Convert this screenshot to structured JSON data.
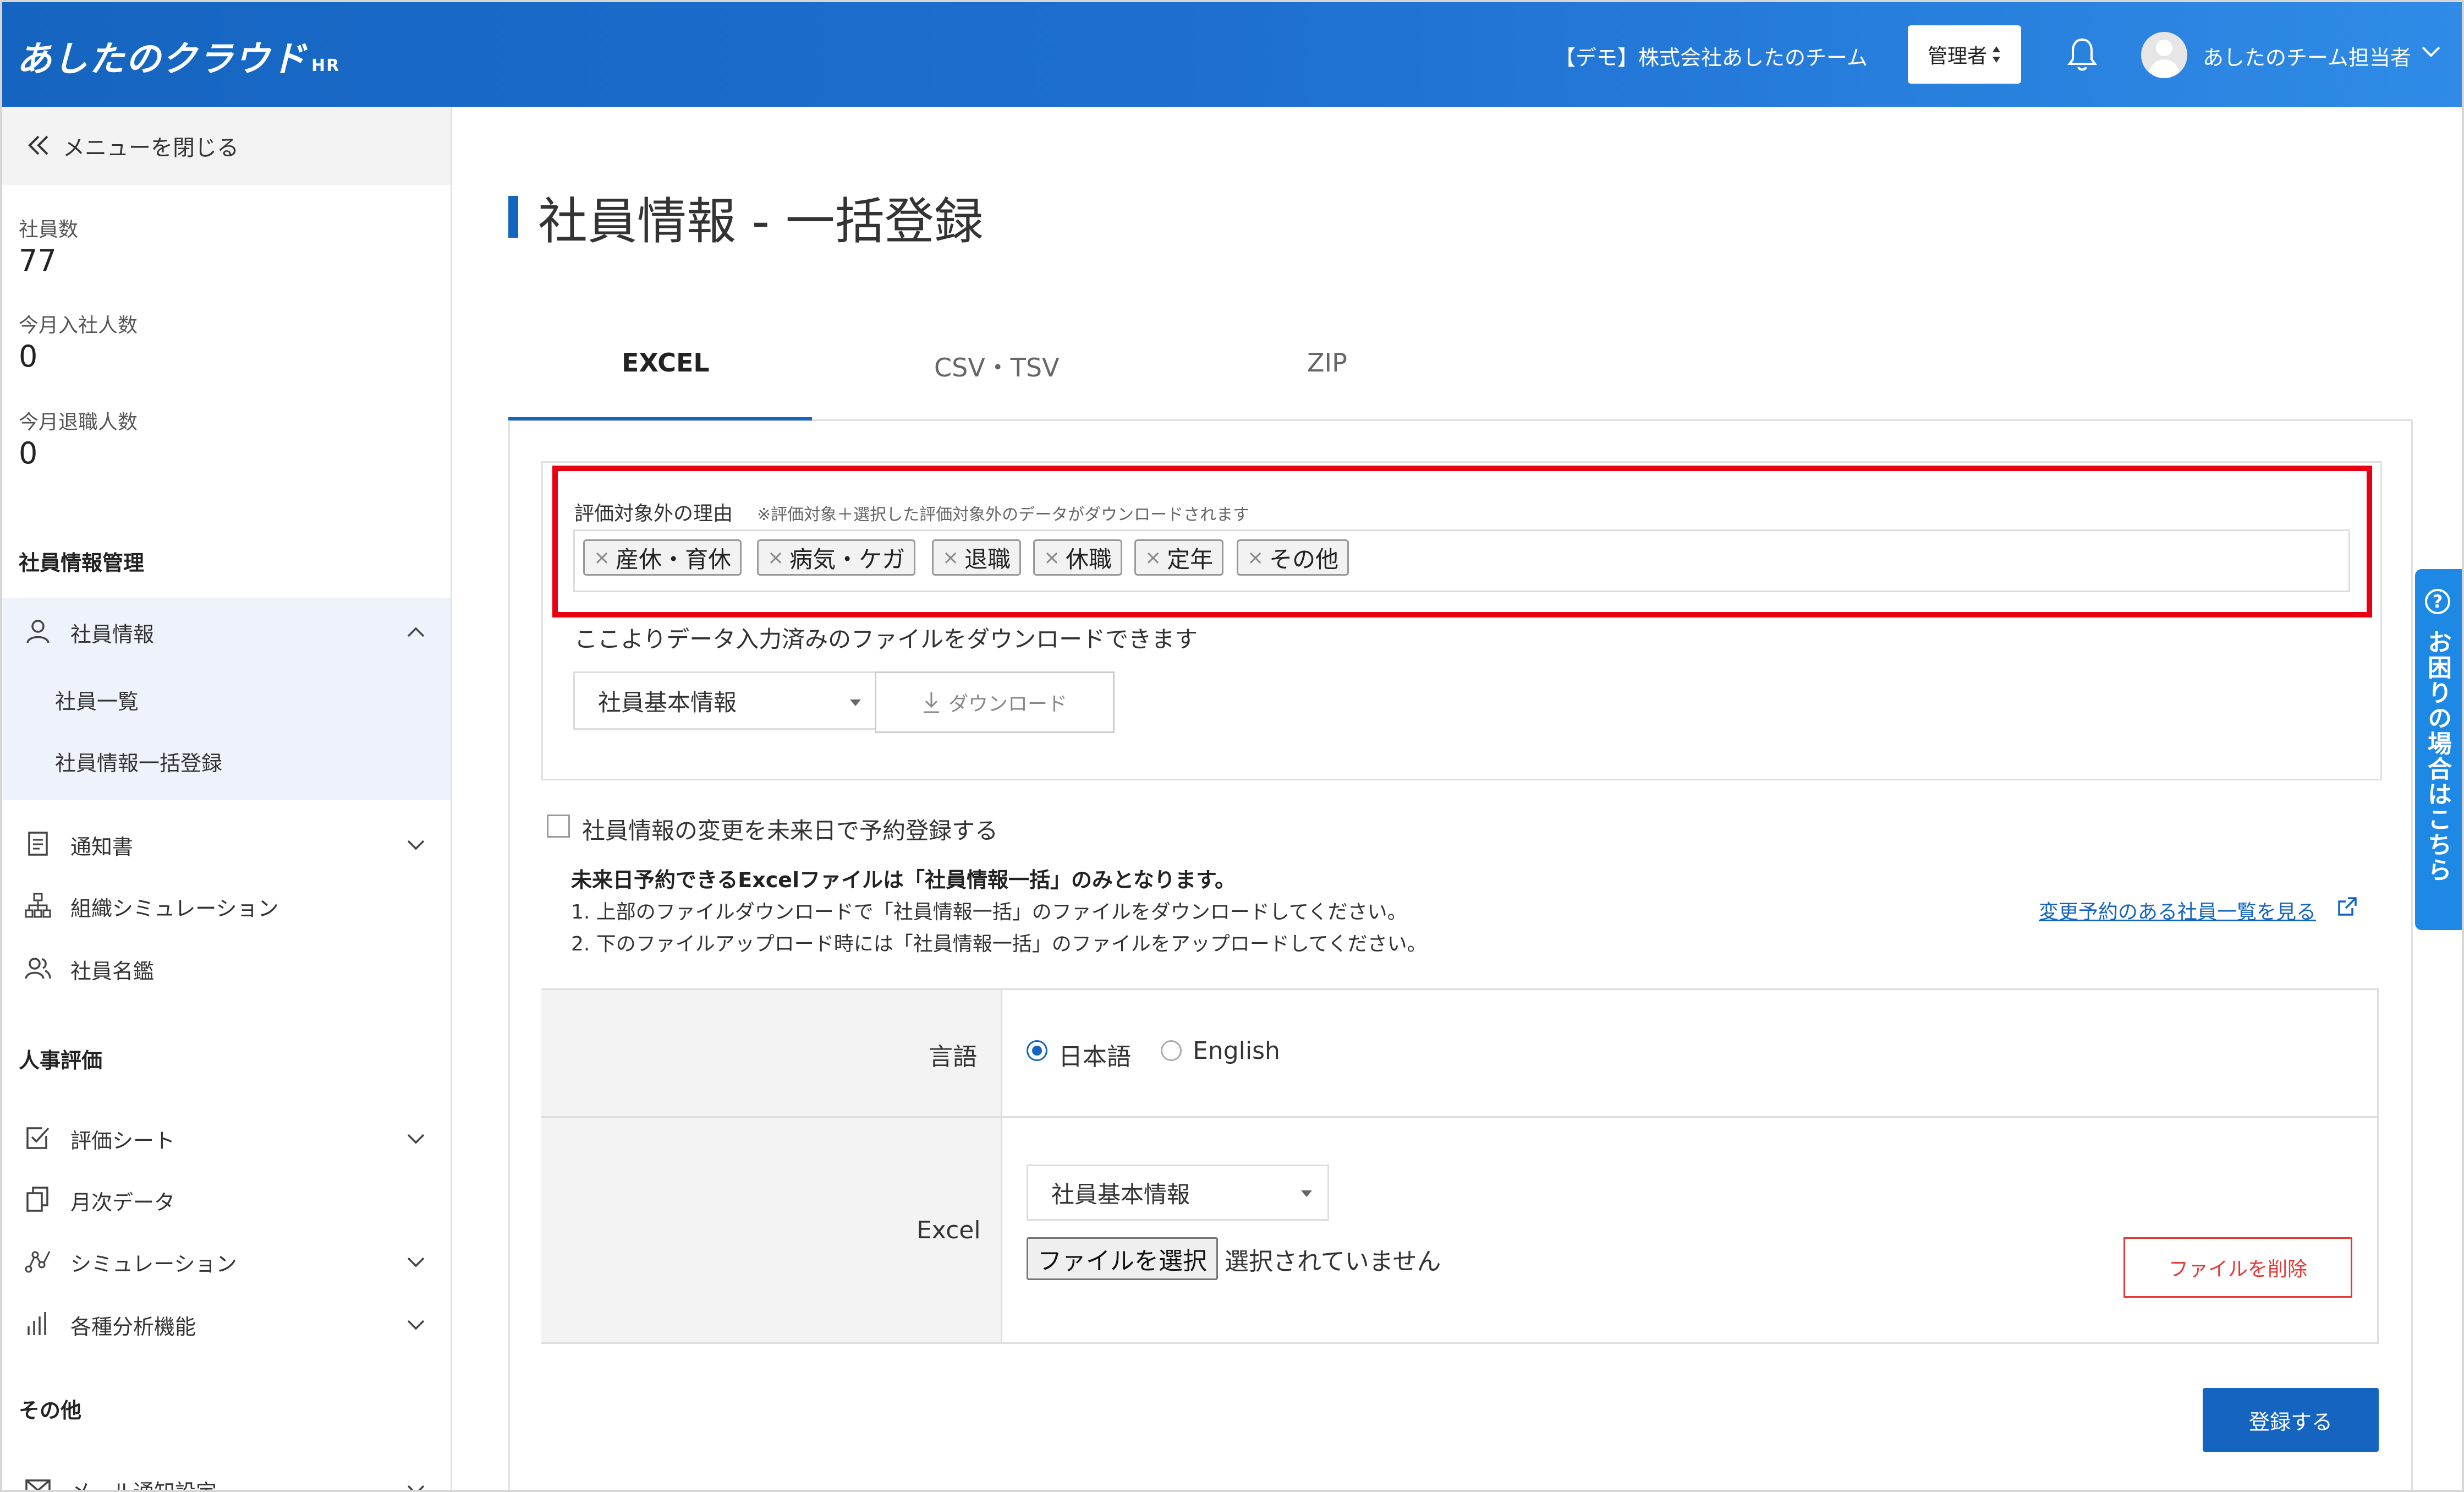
{
  "header": {
    "logo": "あしたのクラウド",
    "logo_sub": "HR",
    "company": "【デモ】株式会社あしたのチーム",
    "role": "管理者",
    "user_name": "あしたのチーム担当者"
  },
  "sidebar": {
    "close_menu": "メニューを閉じる",
    "stats": [
      {
        "label": "社員数",
        "value": "77"
      },
      {
        "label": "今月入社人数",
        "value": "0"
      },
      {
        "label": "今月退職人数",
        "value": "0"
      }
    ],
    "sections": {
      "employee_mgmt": "社員情報管理",
      "hr_eval": "人事評価",
      "other": "その他"
    },
    "employee_items": {
      "employee_info": "社員情報",
      "sub_list": "社員一覧",
      "sub_bulk": "社員情報一括登録",
      "notice": "通知書",
      "org_sim": "組織シミュレーション",
      "directory": "社員名鑑"
    },
    "eval_items": {
      "eval_sheet": "評価シート",
      "monthly": "月次データ",
      "simulation": "シミュレーション",
      "analysis": "各種分析機能"
    },
    "other_items": {
      "mail_settings": "メール通知設定"
    }
  },
  "main": {
    "title": "社員情報 - 一括登録",
    "tabs": [
      "EXCEL",
      "CSV・TSV",
      "ZIP"
    ],
    "eval_exclusion": {
      "label": "評価対象外の理由",
      "note": "※評価対象＋選択した評価対象外のデータがダウンロードされます",
      "tags": [
        "産休・育休",
        "病気・ケガ",
        "退職",
        "休職",
        "定年",
        "その他"
      ]
    },
    "download": {
      "label": "ここよりデータ入力済みのファイルをダウンロードできます",
      "select_value": "社員基本情報",
      "button": "ダウンロード"
    },
    "schedule": {
      "checkbox_label": "社員情報の変更を未来日で予約登録する",
      "note_bold": "未来日予約できるExcelファイルは「社員情報一括」のみとなります。",
      "note_1": "1. 上部のファイルダウンロードで「社員情報一括」のファイルをダウンロードしてください。",
      "note_2": "2. 下のファイルアップロード時には「社員情報一括」のファイルをアップロードしてください。",
      "link": "変更予約のある社員一覧を見る"
    },
    "form": {
      "language_label": "言語",
      "lang_ja": "日本語",
      "lang_en": "English",
      "excel_label": "Excel",
      "excel_select": "社員基本情報",
      "file_button": "ファイルを選択",
      "file_status": "選択されていません",
      "delete_button": "ファイルを削除"
    },
    "submit": "登録する"
  },
  "help_tab": "お困りの場合はこちら",
  "colors": {
    "accent": "#1565c0",
    "highlight": "#e60012",
    "danger": "#e53935"
  }
}
